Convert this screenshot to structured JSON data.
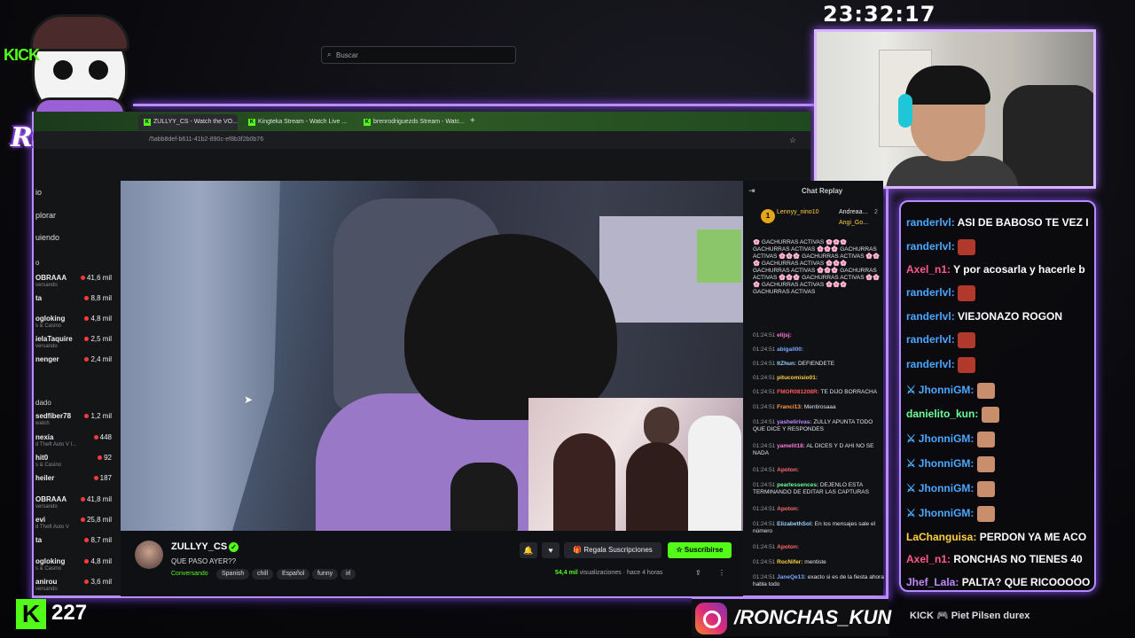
{
  "overlay": {
    "clock": "23:32:17",
    "logo_text": "RONCHAS",
    "kick_viewers": "227",
    "instagram_handle": "/RONCHAS_KUN",
    "sponsors": "KICK  🎮  Piet  Pilsen  durex"
  },
  "browser": {
    "tabs": [
      {
        "label": "ZULLYY_CS - Watch the VO..."
      },
      {
        "label": "Kingteka Stream - Watch Live ..."
      },
      {
        "label": "brenrodriguezds Stream - Watc..."
      }
    ],
    "url": "/5abb8def-b611-41b2-890c-ef8b3f2b0b76",
    "new_tab": "+"
  },
  "kick": {
    "logo": "KICK",
    "search_placeholder": "Buscar",
    "nav": [
      "io",
      "plorar",
      "uiendo"
    ],
    "sections": [
      "o",
      "dado"
    ],
    "channels": [
      {
        "name": "OBRAAA",
        "sub": "versando",
        "viewers": "41,6 mil"
      },
      {
        "name": "ta",
        "sub": "",
        "viewers": "8,8 mil"
      },
      {
        "name": "ogloking",
        "sub": "s & Casino",
        "viewers": "4,8 mil"
      },
      {
        "name": "ielaTaquire",
        "sub": "versando",
        "viewers": "2,5 mil"
      },
      {
        "name": "nenger",
        "sub": "",
        "viewers": "2,4 mil"
      }
    ],
    "channels2": [
      {
        "name": "sedfiber78",
        "sub": "watch",
        "viewers": "1,2 mil"
      },
      {
        "name": "nexia",
        "sub": "d Theft Auto V I...",
        "viewers": "448"
      },
      {
        "name": "hit0",
        "sub": "s & Casino",
        "viewers": "92"
      },
      {
        "name": "heiler",
        "sub": "",
        "viewers": "187"
      },
      {
        "name": "OBRAAA",
        "sub": "versando",
        "viewers": "41,8 mil"
      },
      {
        "name": "evi",
        "sub": "d Theft Auto V",
        "viewers": "25,8 mil"
      },
      {
        "name": "ta",
        "sub": "",
        "viewers": "8,7 mil"
      },
      {
        "name": "ogloking",
        "sub": "s & Casino",
        "viewers": "4,8 mil"
      },
      {
        "name": "anirou",
        "sub": "versando",
        "viewers": "3,6 mil"
      }
    ],
    "stream": {
      "name": "ZULLYY_CS",
      "title": "QUE PASO AYER??",
      "category": "Conversando",
      "tags": [
        "Spanish",
        "chill",
        "Español",
        "funny",
        "irl"
      ],
      "gift_label": "Regala Suscripciones",
      "subscribe_label": "Suscribirse",
      "views": "54,4 mil",
      "views_suffix": "visualizaciones · hace 4 horas"
    },
    "chat": {
      "title": "Chat Replay",
      "top": [
        "Lennyy_nino10",
        "Andreaa...",
        "Angi_Go..."
      ],
      "top_count": "2",
      "messages": [
        {
          "time": "",
          "user": "",
          "text": "🌸 GACHURRAS ACTIVAS 🌸🌸🌸 GACHURRAS ACTIVAS 🌸🌸🌸 GACHURRAS ACTIVAS 🌸🌸🌸 GACHURRAS ACTIVAS 🌸🌸🌸 GACHURRAS ACTIVAS 🌸🌸🌸 GACHURRAS ACTIVAS 🌸🌸🌸 GACHURRAS ACTIVAS 🌸🌸🌸 GACHURRAS ACTIVAS 🌸🌸🌸 GACHURRAS ACTIVAS 🌸🌸🌸 GACHURRAS ACTIVAS",
          "color": "#ffffff"
        },
        {
          "time": "01:24:51",
          "user": "elijsj:",
          "text": "",
          "color": "#ff7ad9"
        },
        {
          "time": "01:24:51",
          "user": "abigail00:",
          "text": "",
          "color": "#7aa8ff"
        },
        {
          "time": "01:24:51",
          "user": "ItZhun:",
          "text": "DEFIENDETE",
          "color": "#9ad1ff"
        },
        {
          "time": "01:24:51",
          "user": "pitucomisio01:",
          "text": "",
          "color": "#ffd23f"
        },
        {
          "time": "01:24:51",
          "user": "FMOR081208R:",
          "text": "TE DIJO BORRACHA",
          "color": "#ff5a5a"
        },
        {
          "time": "01:24:51",
          "user": "Franci13:",
          "text": "Mentirosaaa",
          "color": "#ff9f43"
        },
        {
          "time": "01:24:51",
          "user": "yashelirivas:",
          "text": "ZULLY APUNTA TODO QUE DICE Y RESPONDES",
          "color": "#c08bff"
        },
        {
          "time": "01:24:51",
          "user": "yamelit18:",
          "text": "AL DICES Y D AHI NO SE NADA",
          "color": "#ff7ad9"
        },
        {
          "time": "01:24:51",
          "user": "Apoton:",
          "text": "",
          "color": "#ff6b6b"
        },
        {
          "time": "01:24:51",
          "user": "pearlessences:",
          "text": "DEJENLO ESTA TERMINANDO DE EDITAR LAS CAPTURAS",
          "color": "#6bff9a"
        },
        {
          "time": "01:24:51",
          "user": "Apoton:",
          "text": "",
          "color": "#ff6b6b"
        },
        {
          "time": "01:24:51",
          "user": "ElizabethSol:",
          "text": "En los mensajes sale el número",
          "color": "#9ad1ff"
        },
        {
          "time": "01:24:51",
          "user": "Apoton:",
          "text": "",
          "color": "#ff6b6b"
        },
        {
          "time": "01:24:51",
          "user": "RocNifer:",
          "text": "mentiste",
          "color": "#ffd23f"
        },
        {
          "time": "01:24:51",
          "user": "JaneQe13:",
          "text": "exacto si es de la fiesta ahora habla todo",
          "color": "#7aa8ff"
        }
      ]
    }
  },
  "overlay_chat": [
    {
      "user": "randerlvl:",
      "text": "ASI DE BABOSO TE VEZ I",
      "color": "#4aa8ff",
      "badge": false,
      "emote": ""
    },
    {
      "user": "randerlvl:",
      "text": "",
      "color": "#4aa8ff",
      "badge": false,
      "emote": "angry"
    },
    {
      "user": "Axel_n1:",
      "text": "Y por acosarla y hacerle b",
      "color": "#ff5a8a",
      "badge": false,
      "emote": ""
    },
    {
      "user": "randerlvl:",
      "text": "",
      "color": "#4aa8ff",
      "badge": false,
      "emote": "angry"
    },
    {
      "user": "randerlvl:",
      "text": "VIEJONAZO ROGON",
      "color": "#4aa8ff",
      "badge": false,
      "emote": ""
    },
    {
      "user": "randerlvl:",
      "text": "",
      "color": "#4aa8ff",
      "badge": false,
      "emote": "angry"
    },
    {
      "user": "randerlvl:",
      "text": "",
      "color": "#4aa8ff",
      "badge": false,
      "emote": "angry"
    },
    {
      "user": "JhonniGM:",
      "text": "",
      "color": "#4aa8ff",
      "badge": true,
      "emote": "face"
    },
    {
      "user": "danielito_kun:",
      "text": "",
      "color": "#6bff9a",
      "badge": false,
      "emote": "face"
    },
    {
      "user": "JhonniGM:",
      "text": "",
      "color": "#4aa8ff",
      "badge": true,
      "emote": "face"
    },
    {
      "user": "JhonniGM:",
      "text": "",
      "color": "#4aa8ff",
      "badge": true,
      "emote": "face"
    },
    {
      "user": "JhonniGM:",
      "text": "",
      "color": "#4aa8ff",
      "badge": true,
      "emote": "face"
    },
    {
      "user": "JhonniGM:",
      "text": "",
      "color": "#4aa8ff",
      "badge": true,
      "emote": "face"
    },
    {
      "user": "LaChanguisa:",
      "text": "PERDON YA ME ACO",
      "color": "#ffd23f",
      "badge": false,
      "emote": ""
    },
    {
      "user": "Axel_n1:",
      "text": "RONCHAS NO TIENES 40",
      "color": "#ff5a8a",
      "badge": false,
      "emote": ""
    },
    {
      "user": "Jhef_Lala:",
      "text": "PALTA? QUE RICOOOOO",
      "color": "#c08bff",
      "badge": false,
      "emote": ""
    }
  ]
}
